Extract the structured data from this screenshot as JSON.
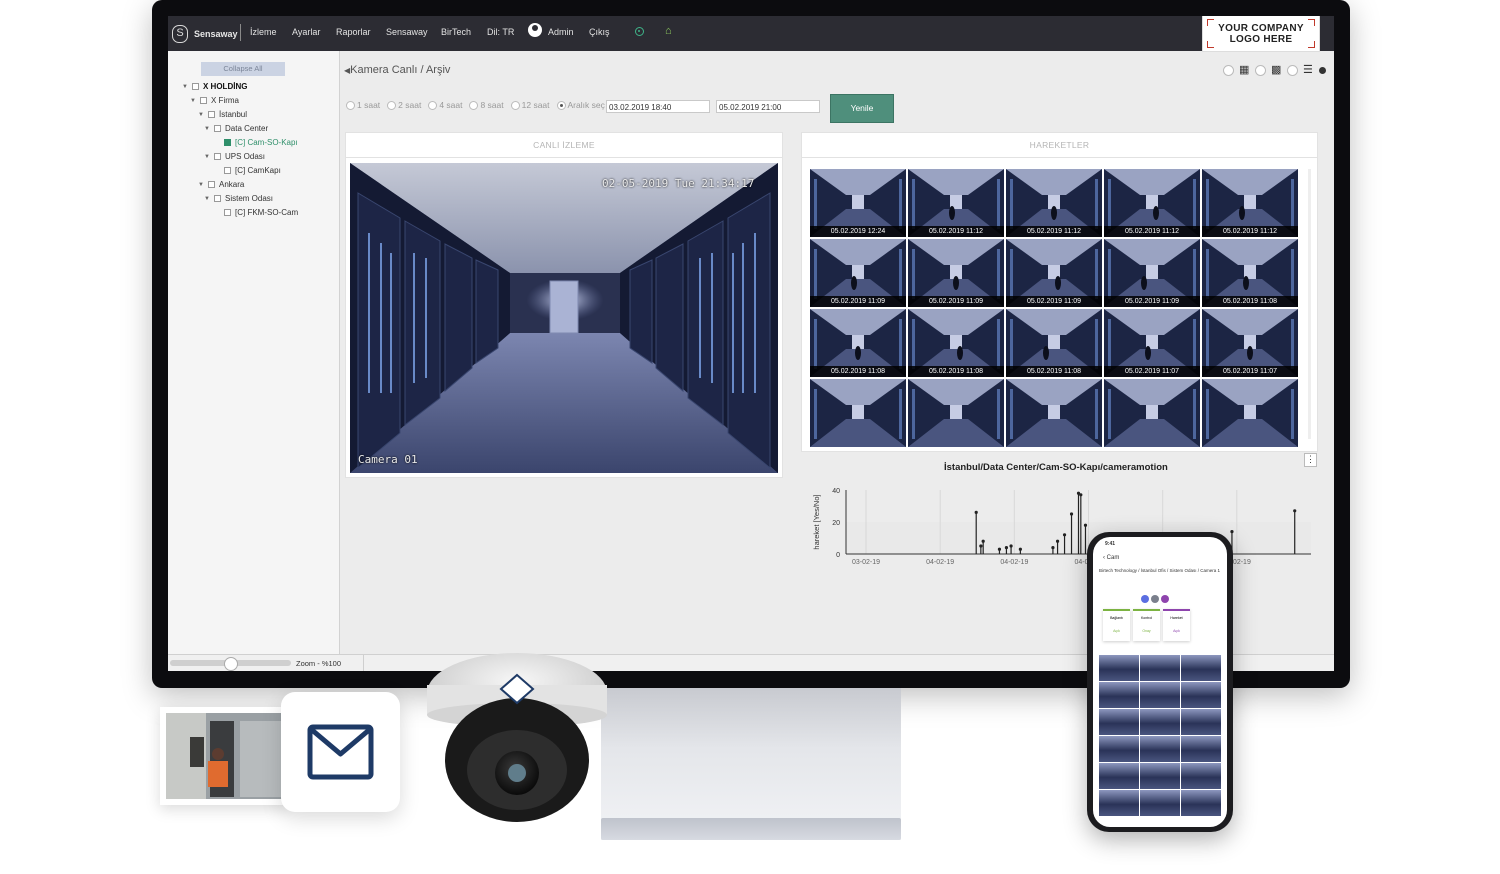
{
  "app": {
    "brand": "Sensaway",
    "nav": [
      "İzleme",
      "Ayarlar",
      "Raporlar",
      "Sensaway",
      "BirTech",
      "Dil: TR"
    ],
    "user": "Admin",
    "logout": "Çıkış",
    "logo_line1": "YOUR COMPANY",
    "logo_line2": "LOGO HERE"
  },
  "sidebar": {
    "collapse_label": "Collapse All",
    "tree": [
      {
        "label": "X HOLDİNG",
        "bold": true
      },
      {
        "label": "X Firma"
      },
      {
        "label": "İstanbul"
      },
      {
        "label": "Data Center"
      },
      {
        "label": "[C] Cam-SO-Kapı",
        "selected": true
      },
      {
        "label": "UPS Odası"
      },
      {
        "label": "[C] CamKapı"
      },
      {
        "label": "Ankara"
      },
      {
        "label": "Sistem Odası"
      },
      {
        "label": "[C] FKM-SO-Cam"
      }
    ],
    "zoom_label": "Zoom - %100",
    "zoom_level": 0.5
  },
  "main": {
    "breadcrumb": "Kamera Canlı / Arşiv",
    "ranges": [
      "1 saat",
      "2 saat",
      "4 saat",
      "8 saat",
      "12 saat",
      "Aralık seç"
    ],
    "selected_range": "Aralık seç",
    "date_from": "03.02.2019 18:40",
    "date_to": "05.02.2019 21:00",
    "refresh_label": "Yenile",
    "live_title": "CANLI İZLEME",
    "live_timestamp": "02-05-2019 Tue 21:34:17",
    "live_camera": "Camera 01",
    "motion_title": "HAREKETLER",
    "motion_thumbs": [
      "05.02.2019 12:24",
      "05.02.2019 11:12",
      "05.02.2019 11:12",
      "05.02.2019 11:12",
      "05.02.2019 11:12",
      "05.02.2019 11:09",
      "05.02.2019 11:09",
      "05.02.2019 11:09",
      "05.02.2019 11:09",
      "05.02.2019 11:08",
      "05.02.2019 11:08",
      "05.02.2019 11:08",
      "05.02.2019 11:08",
      "05.02.2019 11:07",
      "05.02.2019 11:07",
      "",
      "",
      "",
      "",
      ""
    ]
  },
  "chart_data": {
    "type": "line",
    "title": "İstanbul/Data Center/Cam-SO-Kapı/cameramotion",
    "ylabel": "hareket [Yes/No]",
    "ylim": [
      0,
      40
    ],
    "yticks": [
      0,
      20,
      40
    ],
    "xticklabels": [
      "03-02-19",
      "04-02-19",
      "04-02-19",
      "04-02-19",
      "04-0",
      "05-02-19"
    ],
    "spikes": [
      {
        "x": 0.28,
        "y": 26
      },
      {
        "x": 0.29,
        "y": 5
      },
      {
        "x": 0.295,
        "y": 8
      },
      {
        "x": 0.33,
        "y": 3
      },
      {
        "x": 0.345,
        "y": 4
      },
      {
        "x": 0.355,
        "y": 5
      },
      {
        "x": 0.375,
        "y": 3
      },
      {
        "x": 0.445,
        "y": 4
      },
      {
        "x": 0.455,
        "y": 8
      },
      {
        "x": 0.47,
        "y": 12
      },
      {
        "x": 0.485,
        "y": 25
      },
      {
        "x": 0.5,
        "y": 38
      },
      {
        "x": 0.505,
        "y": 37
      },
      {
        "x": 0.515,
        "y": 18
      },
      {
        "x": 0.83,
        "y": 14
      },
      {
        "x": 0.965,
        "y": 27
      }
    ]
  },
  "phone": {
    "time": "9:41",
    "back": "Cam",
    "path": "Birtech Technology / İstanbul Ofis / Sistem Odası / Camera 1",
    "cards": [
      {
        "title": "Bağlantı",
        "value": "Açık",
        "color": "#7cb342"
      },
      {
        "title": "Kontrol",
        "value": "Onay",
        "color": "#7cb342"
      },
      {
        "title": "Hareket",
        "value": "Açık",
        "color": "#8e44ad"
      }
    ]
  },
  "colors": {
    "accent": "#4f8f7c",
    "topbar": "#2c2c33",
    "selected_tree": "#2f8f6a"
  }
}
